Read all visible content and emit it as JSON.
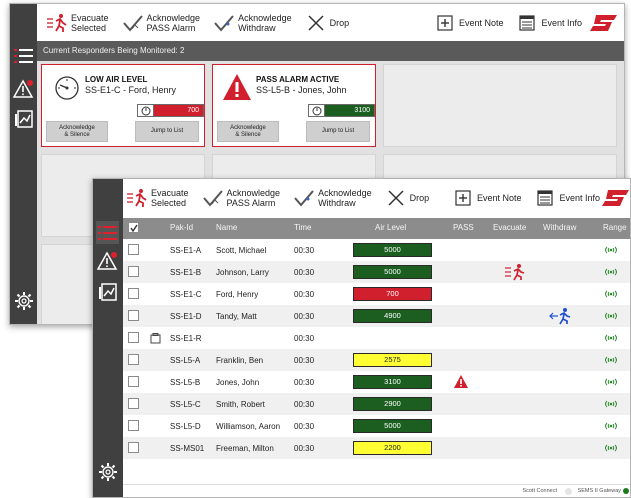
{
  "colors": {
    "alarm_red": "#d0202d",
    "level_green": "#1b5e20",
    "level_yellow": "#ffff33",
    "sidebar": "#404040"
  },
  "toolbar": {
    "evacuate_label": "Evacuate\nSelected",
    "ack_pass_label": "Acknowledge\nPASS Alarm",
    "ack_withdraw_label": "Acknowledge\nWithdraw",
    "drop_label": "Drop",
    "event_note_label": "Event Note",
    "event_info_label": "Event Info"
  },
  "monitor": {
    "header": "Current Responders Being Monitored: 2",
    "alerts": [
      {
        "title": "LOW AIR LEVEL",
        "subtitle": "SS-E1-C - Ford, Henry",
        "level": "700",
        "level_color": "#d0202d",
        "ack_label": "Acknowledge\n& Silence",
        "jump_label": "Jump to List"
      },
      {
        "title": "PASS ALARM ACTIVE",
        "subtitle": "SS-L5-B - Jones, John",
        "level": "3100",
        "level_color": "#1b5e20",
        "ack_label": "Acknowledge\n& Silence",
        "jump_label": "Jump to List"
      }
    ]
  },
  "table": {
    "columns": [
      "Pak-Id",
      "Name",
      "Time",
      "Air Level",
      "PASS",
      "Evacuate",
      "Withdraw",
      "Range"
    ],
    "rows": [
      {
        "pak_id": "SS-E1-A",
        "name": "Scott, Michael",
        "time": "00:30",
        "level": "5000",
        "level_color": "green"
      },
      {
        "pak_id": "SS-E1-B",
        "name": "Johnson, Larry",
        "time": "00:30",
        "level": "5000",
        "level_color": "green",
        "evacuate": true
      },
      {
        "pak_id": "SS-E1-C",
        "name": "Ford, Henry",
        "time": "00:30",
        "level": "700",
        "level_color": "red"
      },
      {
        "pak_id": "SS-E1-D",
        "name": "Tandy, Matt",
        "time": "00:30",
        "level": "4900",
        "level_color": "green",
        "withdraw": true
      },
      {
        "pak_id": "SS-E1-R",
        "name": "",
        "time": "00:30",
        "level": "",
        "level_color": "none",
        "pak_icon": true
      },
      {
        "pak_id": "SS-L5-A",
        "name": "Franklin, Ben",
        "time": "00:30",
        "level": "2575",
        "level_color": "yellow"
      },
      {
        "pak_id": "SS-L5-B",
        "name": "Jones, John",
        "time": "00:30",
        "level": "3100",
        "level_color": "green",
        "pass": true
      },
      {
        "pak_id": "SS-L5-C",
        "name": "Smith, Robert",
        "time": "00:30",
        "level": "2900",
        "level_color": "green"
      },
      {
        "pak_id": "SS-L5-D",
        "name": "Williamson, Aaron",
        "time": "00:30",
        "level": "5000",
        "level_color": "green"
      },
      {
        "pak_id": "SS-MS01",
        "name": "Freeman, Milton",
        "time": "00:30",
        "level": "2200",
        "level_color": "yellow"
      }
    ]
  },
  "status": {
    "scott_connect": "Scott Connect",
    "gateway": "SEMS II Gateway"
  }
}
